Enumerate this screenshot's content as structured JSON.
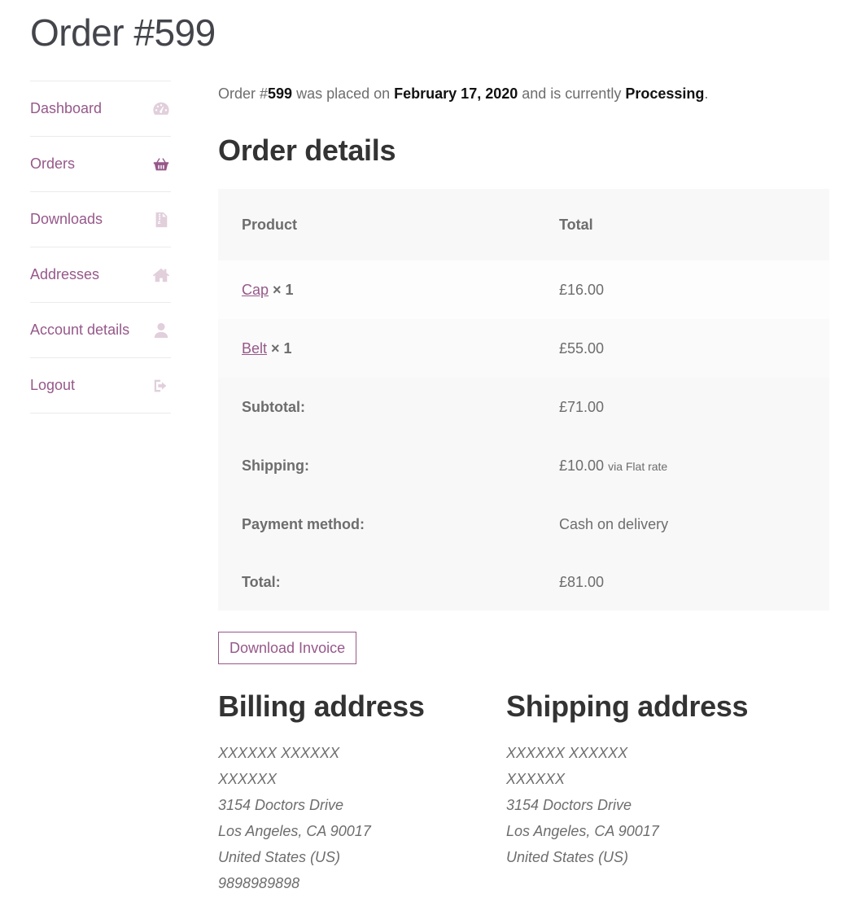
{
  "page": {
    "title": "Order #599"
  },
  "nav": {
    "items": [
      {
        "label": "Dashboard",
        "icon": "dashboard-gauge-icon",
        "active": false
      },
      {
        "label": "Orders",
        "icon": "shopping-basket-icon",
        "active": true
      },
      {
        "label": "Downloads",
        "icon": "file-archive-icon",
        "active": false
      },
      {
        "label": "Addresses",
        "icon": "home-icon",
        "active": false
      },
      {
        "label": "Account details",
        "icon": "user-icon",
        "active": false
      },
      {
        "label": "Logout",
        "icon": "sign-out-icon",
        "active": false
      }
    ]
  },
  "notice": {
    "prefix": "Order #",
    "order_number": "599",
    "placed_text": " was placed on ",
    "date": "February 17, 2020",
    "status_text": " and is currently ",
    "status": "Processing",
    "suffix": "."
  },
  "order_details": {
    "title": "Order details",
    "headers": {
      "product": "Product",
      "total": "Total"
    },
    "items": [
      {
        "name": "Cap",
        "qty": "× 1",
        "total": "£16.00"
      },
      {
        "name": "Belt",
        "qty": "× 1",
        "total": "£55.00"
      }
    ],
    "summary": {
      "subtotal_label": "Subtotal:",
      "subtotal": "£71.00",
      "shipping_label": "Shipping:",
      "shipping": "£10.00",
      "shipping_via": "via Flat rate",
      "payment_label": "Payment method:",
      "payment": "Cash on delivery",
      "total_label": "Total:",
      "total": "£81.00"
    }
  },
  "actions": {
    "download_invoice": "Download Invoice"
  },
  "billing": {
    "title": "Billing address",
    "lines": [
      "XXXXXX XXXXXX",
      "XXXXXX",
      "3154 Doctors Drive",
      "Los Angeles, CA 90017",
      "United States (US)",
      "9898989898"
    ]
  },
  "shipping": {
    "title": "Shipping address",
    "lines": [
      "XXXXXX XXXXXX",
      "XXXXXX",
      "3154 Doctors Drive",
      "Los Angeles, CA 90017",
      "United States (US)"
    ]
  },
  "colors": {
    "accent": "#96588a",
    "icon_dim": "#e1cfdc",
    "heading": "#333333",
    "text": "#6d6d6d"
  }
}
